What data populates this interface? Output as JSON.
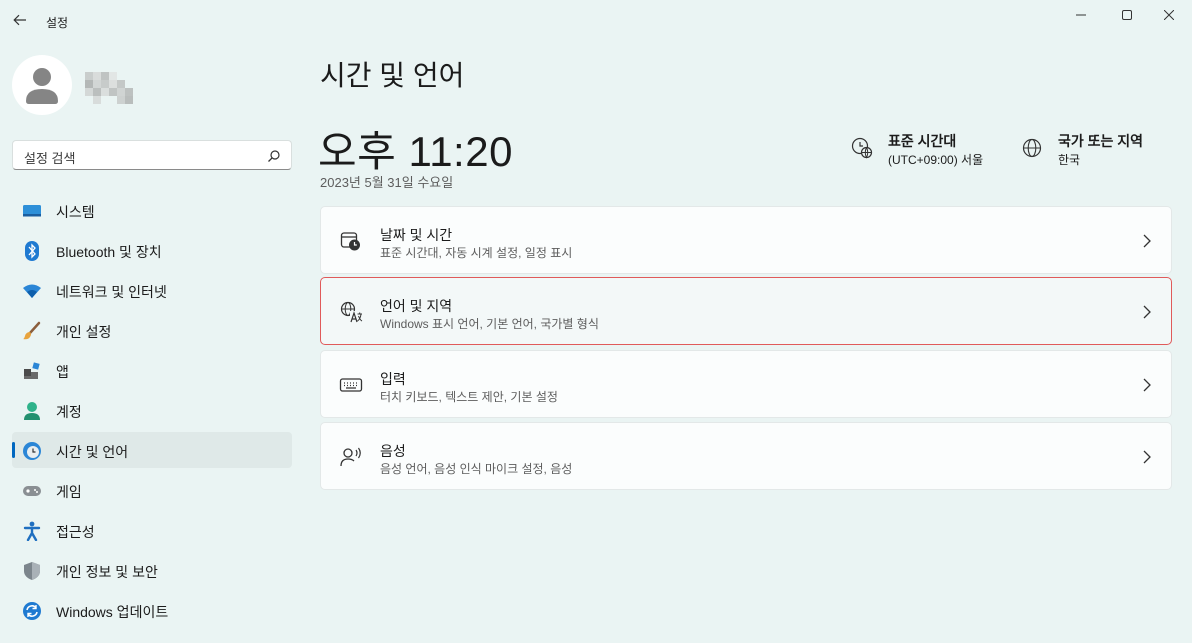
{
  "window": {
    "title": "설정"
  },
  "search": {
    "placeholder": "설정 검색"
  },
  "sidebar": {
    "items": [
      {
        "label": "시스템",
        "icon": "system-display-icon"
      },
      {
        "label": "Bluetooth 및 장치",
        "icon": "bluetooth-icon"
      },
      {
        "label": "네트워크 및 인터넷",
        "icon": "wifi-icon"
      },
      {
        "label": "개인 설정",
        "icon": "brush-icon"
      },
      {
        "label": "앱",
        "icon": "apps-icon"
      },
      {
        "label": "계정",
        "icon": "account-icon"
      },
      {
        "label": "시간 및 언어",
        "icon": "time-language-icon",
        "active": true
      },
      {
        "label": "게임",
        "icon": "gamepad-icon"
      },
      {
        "label": "접근성",
        "icon": "accessibility-icon"
      },
      {
        "label": "개인 정보 및 보안",
        "icon": "shield-icon"
      },
      {
        "label": "Windows 업데이트",
        "icon": "update-icon"
      }
    ]
  },
  "main": {
    "title": "시간 및 언어",
    "time": "오후 11:20",
    "date": "2023년 5월 31일 수요일",
    "timezone": {
      "title": "표준 시간대",
      "value": "(UTC+09:00) 서울"
    },
    "region": {
      "title": "국가 또는 지역",
      "value": "한국"
    },
    "cards": [
      {
        "title": "날짜 및 시간",
        "subtitle": "표준 시간대, 자동 시계 설정, 일정 표시",
        "icon": "calendar-clock-icon"
      },
      {
        "title": "언어 및 지역",
        "subtitle": "Windows 표시 언어, 기본 언어, 국가별 형식",
        "icon": "language-icon",
        "highlighted": true
      },
      {
        "title": "입력",
        "subtitle": "터치 키보드, 텍스트 제안, 기본 설정",
        "icon": "keyboard-icon"
      },
      {
        "title": "음성",
        "subtitle": "음성 언어, 음성 인식 마이크 설정, 음성",
        "icon": "speech-icon"
      }
    ]
  },
  "colors": {
    "background": "#eaf4f3",
    "accent": "#0067c0",
    "highlight_border": "#e05a5a"
  }
}
